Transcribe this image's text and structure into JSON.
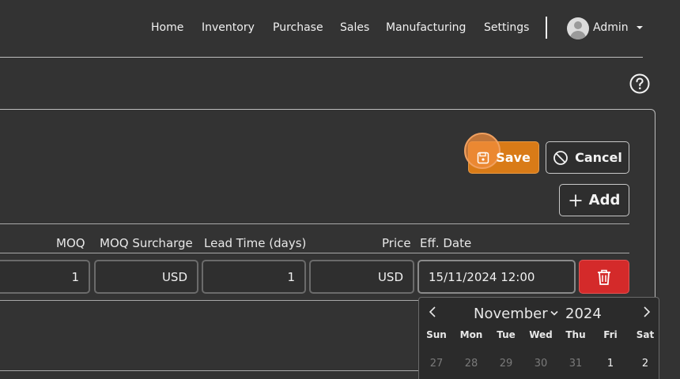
{
  "nav": {
    "items": [
      "Home",
      "Inventory",
      "Purchase",
      "Sales",
      "Manufacturing",
      "Settings"
    ],
    "user": "Admin"
  },
  "actions": {
    "save": "Save",
    "cancel": "Cancel",
    "add": "Add"
  },
  "table": {
    "headers": [
      "MOQ",
      "MOQ Surcharge",
      "Lead Time (days)",
      "Price",
      "Eff. Date"
    ],
    "row": {
      "moq": "1",
      "moq_surcharge": "USD",
      "lead_time": "1",
      "price": "USD",
      "eff_date": "15/11/2024 12:00"
    }
  },
  "datepicker": {
    "month": "November",
    "year": "2024",
    "weekdays": [
      "Sun",
      "Mon",
      "Tue",
      "Wed",
      "Thu",
      "Fri",
      "Sat"
    ],
    "first_row": [
      "27",
      "28",
      "29",
      "30",
      "31",
      "1",
      "2"
    ]
  },
  "colors": {
    "background": "#333333",
    "save": "#d97b17",
    "delete": "#d42a2a"
  }
}
